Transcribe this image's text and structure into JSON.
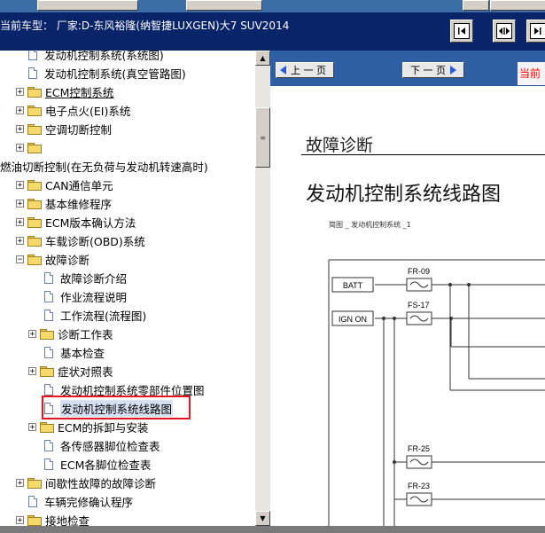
{
  "header": {
    "title": "当前车型：  厂家:D-东风裕隆(纳智捷LUXGEN)大7 SUV2014"
  },
  "tree": {
    "items": [
      {
        "label": "发动机控制系统(系统图)",
        "type": "page",
        "level": 2
      },
      {
        "label": "发动机控制系统(真空管路图)",
        "type": "page",
        "level": 2
      },
      {
        "label": "ECM控制系统",
        "type": "folder",
        "level": 1,
        "underline": true
      },
      {
        "label": "电子点火(EI)系统",
        "type": "folder",
        "level": 1
      },
      {
        "label": "空调切断控制",
        "type": "folder",
        "level": 1
      },
      {
        "label": "",
        "type": "folder",
        "level": 1
      },
      {
        "label": "燃油切断控制(在无负荷与发动机转速高时)",
        "type": "text",
        "level": 0
      },
      {
        "label": "CAN通信单元",
        "type": "folder",
        "level": 1
      },
      {
        "label": "基本维修程序",
        "type": "folder",
        "level": 1
      },
      {
        "label": "ECM版本确认方法",
        "type": "folder",
        "level": 1
      },
      {
        "label": "车载诊断(OBD)系统",
        "type": "folder",
        "level": 1
      },
      {
        "label": "故障诊断",
        "type": "folder",
        "level": 1,
        "expanded": true
      },
      {
        "label": "故障诊断介绍",
        "type": "page",
        "level": 3
      },
      {
        "label": "作业流程说明",
        "type": "page",
        "level": 3
      },
      {
        "label": "工作流程(流程图)",
        "type": "page",
        "level": 3
      },
      {
        "label": "诊断工作表",
        "type": "folder",
        "level": 2
      },
      {
        "label": "基本检查",
        "type": "page",
        "level": 3
      },
      {
        "label": "症状对照表",
        "type": "folder",
        "level": 2
      },
      {
        "label": "发动机控制系统零部件位置图",
        "type": "page",
        "level": 3
      },
      {
        "label": "发动机控制系统线路图",
        "type": "page",
        "level": 3,
        "selected": true
      },
      {
        "label": "ECM的拆卸与安装",
        "type": "folder",
        "level": 2
      },
      {
        "label": "各传感器脚位检查表",
        "type": "page",
        "level": 3
      },
      {
        "label": "ECM各脚位检查表",
        "type": "page",
        "level": 3
      },
      {
        "label": "间歇性故障的故障诊断",
        "type": "folder",
        "level": 1
      },
      {
        "label": "车辆完修确认程序",
        "type": "page",
        "level": 2
      },
      {
        "label": "接地检查",
        "type": "folder",
        "level": 1
      }
    ],
    "expand_symbol": "+",
    "collapse_symbol": "−"
  },
  "doc": {
    "prev_label": "上 一 页",
    "next_label": "下 一 页",
    "current_label": "当前",
    "section_title": "故障诊断",
    "page_title": "发动机控制系统线路图",
    "caption": "简图 _ 发动机控制系统 _1",
    "diagram": {
      "batt": "BATT",
      "ign": "IGN ON",
      "fuses": [
        "FR-09",
        "FS-17",
        "FR-25",
        "FR-23"
      ]
    }
  },
  "colors": {
    "header_bg": "#0a246a",
    "docbar_bg": "#2e5fa3",
    "selection_border": "#e8141e",
    "current_label": "#ff0000"
  },
  "icons": {
    "nav1": "first-page-icon",
    "nav2": "fit-width-icon",
    "nav3": "next-icon"
  }
}
